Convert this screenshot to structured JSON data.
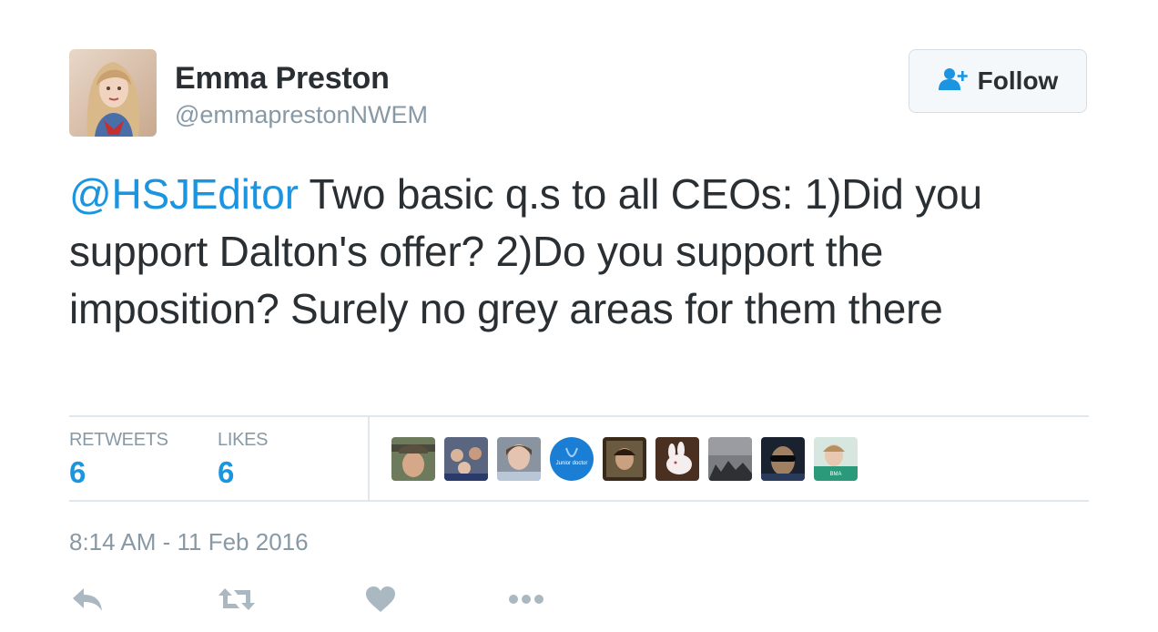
{
  "author": {
    "name": "Emma Preston",
    "handle": "@emmaprestonNWEM"
  },
  "follow_button": {
    "label": "Follow",
    "icon": "follow-user-icon"
  },
  "tweet": {
    "mention": "@HSJEditor",
    "text": " Two basic q.s to all CEOs: 1)Did you support Dalton's offer? 2)Do you support the imposition? Surely no grey areas for them there"
  },
  "stats": {
    "retweets_label": "RETWEETS",
    "retweets_count": "6",
    "likes_label": "LIKES",
    "likes_count": "6"
  },
  "likers": [
    {
      "name": "liker-avatar-1"
    },
    {
      "name": "liker-avatar-2"
    },
    {
      "name": "liker-avatar-3"
    },
    {
      "name": "liker-avatar-4",
      "text": "Junior doctor"
    },
    {
      "name": "liker-avatar-5"
    },
    {
      "name": "liker-avatar-6"
    },
    {
      "name": "liker-avatar-7"
    },
    {
      "name": "liker-avatar-8"
    },
    {
      "name": "liker-avatar-9",
      "text": "BMA"
    }
  ],
  "timestamp": "8:14 AM - 11 Feb 2016",
  "actions": [
    "reply-icon",
    "retweet-icon",
    "like-icon",
    "more-icon"
  ],
  "colors": {
    "link": "#1b95e0",
    "text": "#292f33",
    "muted": "#8899a6",
    "icon": "#aab8c2",
    "divider": "#e1e8ed"
  }
}
